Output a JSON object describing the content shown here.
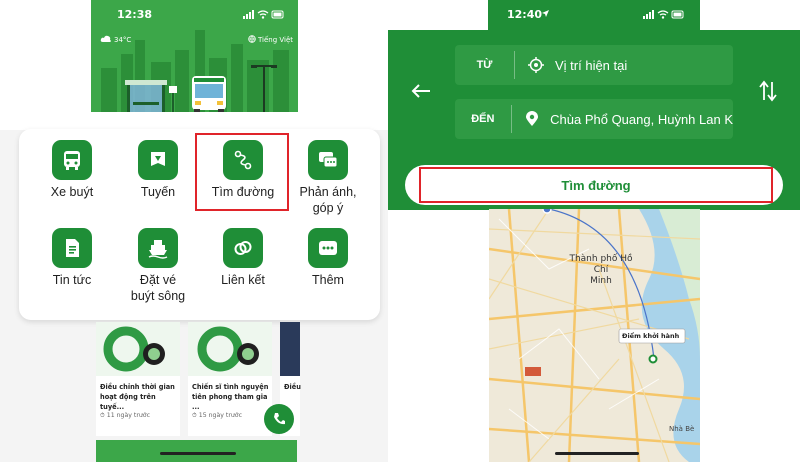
{
  "left": {
    "status_time": "12:38",
    "weather": "34°C",
    "language": "Tiếng Việt",
    "menu": [
      {
        "label": "Xe buýt",
        "icon": "bus-icon"
      },
      {
        "label": "Tuyến",
        "icon": "route-flag-icon"
      },
      {
        "label": "Tìm đường",
        "icon": "path-icon"
      },
      {
        "label": "Phản ánh,\ngóp ý",
        "icon": "chat-icon"
      },
      {
        "label": "Tin tức",
        "icon": "document-icon"
      },
      {
        "label": "Đặt vé\nbuýt sông",
        "icon": "boat-icon"
      },
      {
        "label": "Liên kết",
        "icon": "link-icon"
      },
      {
        "label": "Thêm",
        "icon": "more-icon"
      }
    ],
    "news": [
      {
        "title": "Điều chỉnh thời gian hoạt động trên tuyế...",
        "time": "11 ngày trước"
      },
      {
        "title": "Chiến sĩ tình nguyện tiên phong tham gia ...",
        "time": "15 ngày trước"
      },
      {
        "title": "Điều",
        "time": ""
      }
    ]
  },
  "right": {
    "status_time": "12:40",
    "from_label": "TỪ",
    "from_value": "Vị trí hiện tại",
    "to_label": "ĐẾN",
    "to_value": "Chùa Phổ Quang, Huỳnh Lan K",
    "search_label": "Tìm đường",
    "map": {
      "city_line1": "Thành phố Hồ Chí",
      "city_line2": "Minh",
      "start_label": "Điểm khởi hành",
      "district": "Nhà Bè"
    }
  },
  "colors": {
    "primary": "#1f8e37",
    "highlight": "#e0242a",
    "hero": "#3ca749"
  }
}
